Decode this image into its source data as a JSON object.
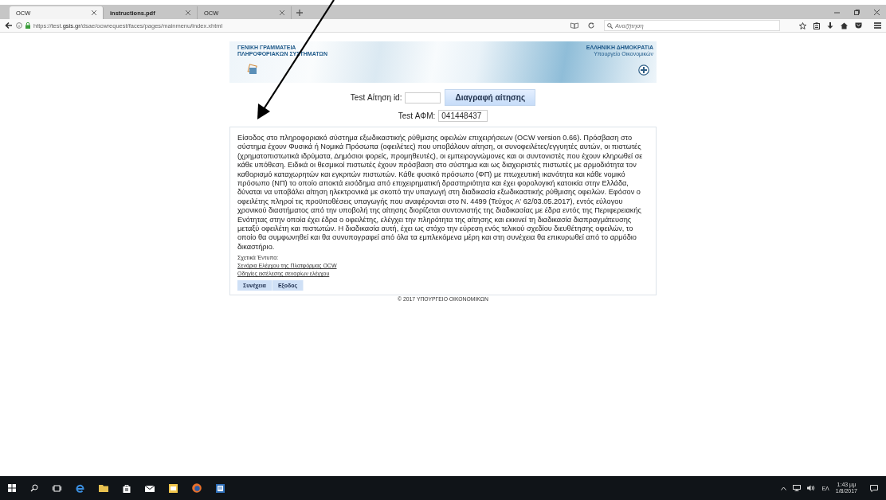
{
  "browser": {
    "tabs": [
      {
        "title": "OCW",
        "selected": true
      },
      {
        "title": "instructions.pdf",
        "selected": false
      },
      {
        "title": "OCW",
        "selected": false
      }
    ],
    "url": "https://test.**gsis.gr**/dsae/ocwrequest/faces/pages/mainmenu/index.xhtml",
    "search": {
      "placeholder": "Αναζήτηση"
    }
  },
  "banner": {
    "left_lines": [
      "ΓΕΝΙΚΗ ΓΡΑΜΜΑΤΕΙΑ",
      "ΠΛΗΡΟΦΟΡΙΑΚΩΝ ΣΥΣΤΗΜΑΤΩΝ"
    ],
    "right_title": "ΕΛΛΗΝΙΚΗ ΔΗΜΟΚΡΑΤΙΑ",
    "right_subtitle": "Υπουργείο Οικονομικών"
  },
  "form": {
    "request_id_label": "Test Αίτηση id:",
    "delete_button": "Διαγραφή αίτησης",
    "afm_label": "Test ΑΦΜ:",
    "afm_value": "041448437"
  },
  "intro": "Είσοδος στο πληροφοριακό σύστημα εξωδικαστικής ρύθμισης οφειλών επιχειρήσεων (OCW version 0.66). Πρόσβαση στο σύστημα έχουν Φυσικά ή Νομικά Πρόσωπα (οφειλέτες) που υποβάλουν αίτηση, οι συνοφειλέτες/εγγυητές αυτών, οι πιστωτές (χρηματοπιστωτικά ιδρύματα, Δημόσιοι φορείς, προμηθευτές), οι εμπειρογνώμονες και οι συντονιστές που έχουν κληρωθεί σε κάθε υπόθεση. Ειδικά οι θεσμικοί πιστωτές έχουν πρόσβαση στο σύστημα και ως διαχειριστές πιστωτές με αρμοδιότητα τον καθορισμό καταχωρητών και εγκριτών πιστωτών. Κάθε φυσικό πρόσωπο (ΦΠ) με πτωχευτική ικανότητα και κάθε νομικό πρόσωπο (ΝΠ) το οποίο αποκτά εισόδημα από επιχειρηματική δραστηριότητα και έχει φορολογική κατοικία στην Ελλάδα, δύναται να υποβάλει αίτηση ηλεκτρονικά με σκοπό την υπαγωγή στη διαδικασία εξωδικαστικής ρύθμισης οφειλών. Εφόσον ο οφειλέτης πληροί τις προϋποθέσεις υπαγωγής που αναφέρονται στο Ν. 4499 (Τεύχος Α' 62/03.05.2017), εντός εύλογου χρονικού διαστήματος από την υποβολή της αίτησης διορίζεται συντονιστής της διαδικασίας με έδρα εντός της Περιφερειακής Ενότητας στην οποία έχει έδρα ο οφειλέτης, ελέγχει την πληρότητα της αίτησης και εκκινεί τη διαδικασία διαπραγμάτευσης μεταξύ οφειλέτη και πιστωτών. Η διαδικασία αυτή, έχει ως στόχο την εύρεση ενός τελικού σχεδίου διευθέτησης οφειλών, το οποίο θα συμφωνηθεί και θα συνυπογραφεί από όλα τα εμπλεκόμενα μέρη και στη συνέχεια θα επικυρωθεί από το αρμόδιο δικαστήριο.",
  "related_label": "Σχετικά Έντυπα:",
  "links": [
    "Σενάρια Ελέγχου της Πλατφόρμας OCW",
    "Οδηγίες εκτέλεσης σεναρίων ελέγχου"
  ],
  "buttons": [
    "Συνέχεια",
    "Εξοδος"
  ],
  "footer": "© 2017 ΥΠΟΥΡΓΕΙΟ ΟΙΚΟΝΟΜΙΚΩΝ",
  "taskbar": {
    "language": "ΕΛ",
    "time": "1:43 μμ",
    "date": "1/8/2017"
  }
}
